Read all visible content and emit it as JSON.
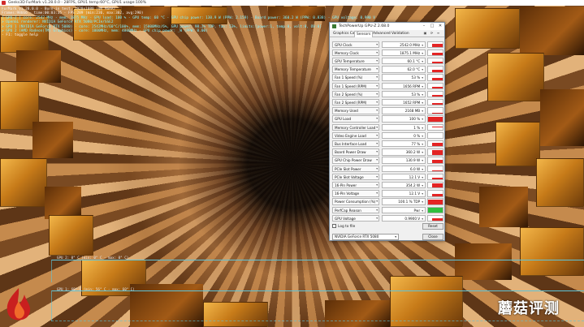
{
  "window": {
    "title": "Geeks3D FurMark v1.28.0.0 - 28FPS, GPU1 temp:60°C, GPU1 usage:100%"
  },
  "osd": {
    "lines": [
      {
        "text": "FurMark v1.28.0.0 - Burn-in test, 1920x1080 (0X MSAA)",
        "color": "#f2f2f2"
      },
      {
        "text": "Frames:98666 - time:00:03:35 - FPS:289 (min:236, max:302, avg:290)",
        "color": "#f2f2f2"
      },
      {
        "text": "[ GPU-Z ] core: 2542 MHz - mem: 1875 MHz - GPU load: 100 % - GPU temp: 60 °C - GPU chip power: 130.9 W (PPW: 2.159) - Board power: 360.2 W (PPW: 0.838) - GPU voltage: 0.990 V",
        "color": "#7ff0ff"
      },
      {
        "text": "> OpenGL renderer: NVIDIA GeForce RTX 5080/PCIe/SSE2",
        "color": "#7ff0ff"
      },
      {
        "text": "> GPU 1 (NVIDIA GeForce RTX 5080) - core: 2542MHz/60°C/100%, mem: 15000MHz/6%, GPU power: 98.2% TDP, fan: 53%, limits:[power:1, temp:0, volt:0, OV:0]",
        "color": "#7ff0ff"
      },
      {
        "text": "> GPU 2 (AMD Radeon(TM) Graphics) - core: 1000MHz, mem: 4800MHz - GPU chip power: _W (PPW: 0.00)",
        "color": "#7ff0ff"
      },
      {
        "text": "- F1: toggle help",
        "color": "#f2f2f2"
      }
    ]
  },
  "graphs": {
    "gpu2_label": "GPU 2: 0° C (min: 0° C - max: 0° C)",
    "gpu1_label": "GPU 1: 60° C (min: 56° C - max: 60° C)"
  },
  "watermark": "蘑菇评测",
  "gpuz": {
    "title": "TechPowerUp GPU-Z 2.68.0",
    "tabs": [
      "Graphics Card",
      "Sensors",
      "Advanced",
      "Validation"
    ],
    "active_tab": "Sensors",
    "sensors": [
      {
        "name": "GPU Clock",
        "value": "2542.0 MHz",
        "graph": 0.55
      },
      {
        "name": "Memory Clock",
        "value": "1875.1 MHz",
        "graph": 0.5
      },
      {
        "name": "GPU Temperature",
        "value": "60.1 °C",
        "graph": 0.45
      },
      {
        "name": "Memory Temperature",
        "value": "62.0 °C",
        "graph": 0.45
      },
      {
        "name": "Fan 1 Speed (%)",
        "value": "53 %",
        "graph": 0.4
      },
      {
        "name": "Fan 1 Speed (RPM)",
        "value": "1656 RPM",
        "graph": 0.35
      },
      {
        "name": "Fan 2 Speed (%)",
        "value": "53 %",
        "graph": 0.4
      },
      {
        "name": "Fan 2 Speed (RPM)",
        "value": "1652 RPM",
        "graph": 0.35
      },
      {
        "name": "Memory Used",
        "value": "2168 MB",
        "graph": 0.15
      },
      {
        "name": "GPU Load",
        "value": "100 %",
        "graph": 0.95
      },
      {
        "name": "Memory Controller Load",
        "value": "1 %",
        "graph": 0.05
      },
      {
        "name": "Video Engine Load",
        "value": "0 %",
        "graph": 0.0
      },
      {
        "name": "Bus Interface Load",
        "value": "77 %",
        "graph": 0.75
      },
      {
        "name": "Board Power Draw",
        "value": "360.2 W",
        "graph": 0.85
      },
      {
        "name": "GPU Chip Power Draw",
        "value": "130.9 W",
        "graph": 0.6
      },
      {
        "name": "PCIe Slot Power",
        "value": "6.0 W",
        "graph": 0.1
      },
      {
        "name": "PCIe Slot Voltage",
        "value": "12.1 V",
        "graph": 0.35
      },
      {
        "name": "16-Pin Power",
        "value": "354.2 W",
        "graph": 0.85
      },
      {
        "name": "16-Pin Voltage",
        "value": "12.1 V",
        "graph": 0.35
      },
      {
        "name": "Power Consumption (%)",
        "value": "100.1 % TDP",
        "graph": 0.9
      },
      {
        "name": "PerfCap Reason",
        "value": "Pwr",
        "graph": 1.0,
        "graph_color": "green"
      },
      {
        "name": "GPU Voltage",
        "value": "0.9900 V",
        "graph": 0.55
      }
    ],
    "log_to_file": "Log to file",
    "reset": "Reset",
    "close": "Close",
    "gpu_select": "NVIDIA GeForce RTX 5080"
  },
  "colors": {
    "accent_red": "#e32424",
    "perfcap_green": "#2fbf3f",
    "osd_cyan": "#7ff0ff",
    "graph_line": "#5ec4d8"
  }
}
